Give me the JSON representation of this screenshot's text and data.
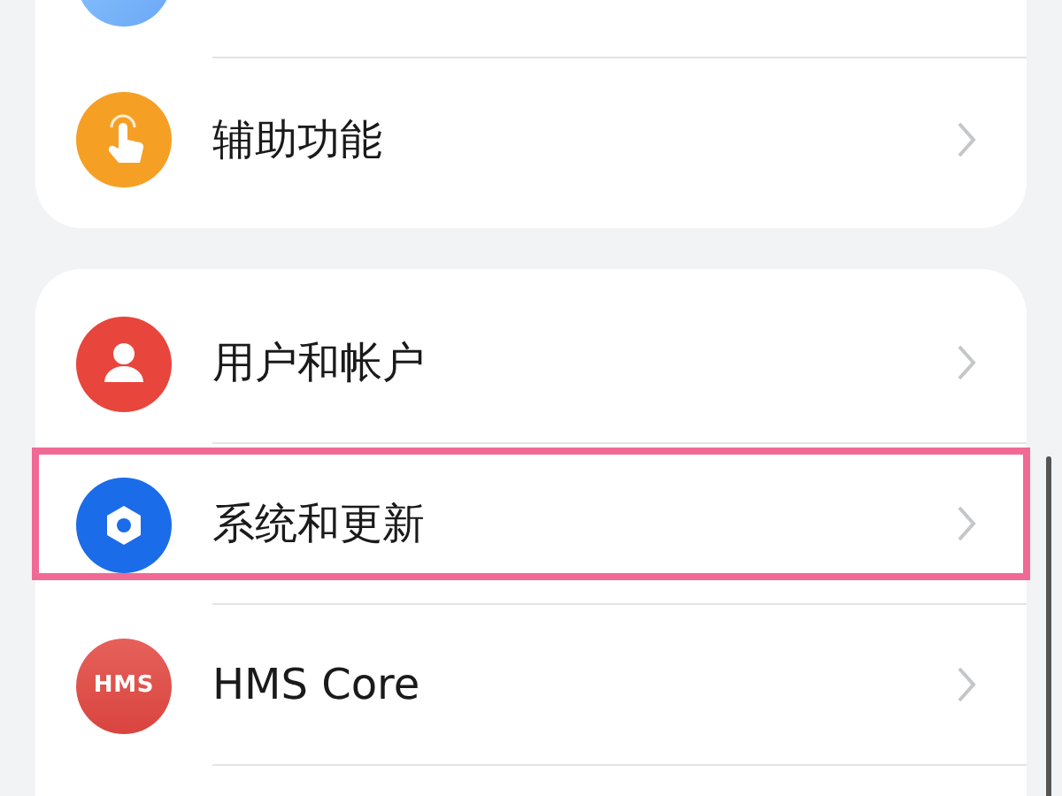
{
  "groups": [
    {
      "items": [
        {
          "kind": "blue",
          "highlighted": false
        },
        {
          "kind": "hand",
          "label": "辅助功能",
          "highlighted": false
        }
      ]
    },
    {
      "items": [
        {
          "kind": "person",
          "label": "用户和帐户",
          "highlighted": false
        },
        {
          "kind": "gear",
          "label": "系统和更新",
          "highlighted": true
        },
        {
          "kind": "hms",
          "label": "HMS Core",
          "badge_text": "HMS",
          "highlighted": false
        }
      ]
    }
  ]
}
